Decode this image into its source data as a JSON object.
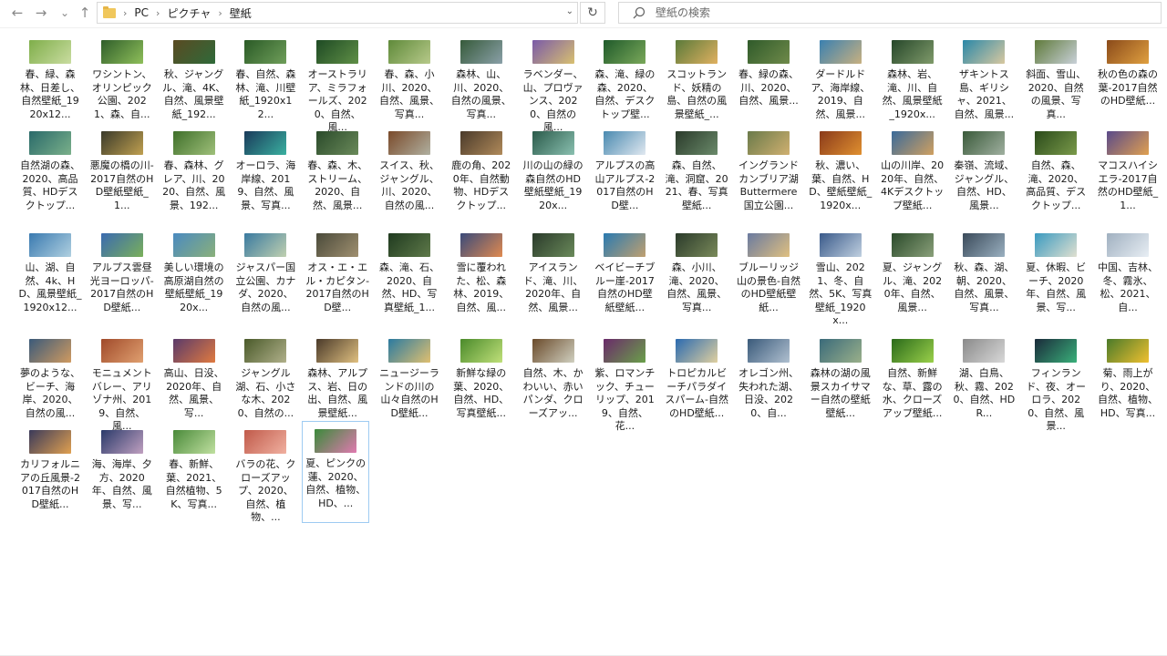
{
  "nav": {
    "back": "←",
    "forward": "→",
    "recent": "⌄",
    "up": "↑"
  },
  "breadcrumb": [
    "PC",
    "ピクチャ",
    "壁紙"
  ],
  "breadcrumb_sep": "›",
  "search": {
    "placeholder": "壁紙の検索"
  },
  "items": [
    {
      "label": "春、緑、森林、日差し、自然壁紙_1920x12...",
      "g": [
        "#7fae4a",
        "#c9dca0"
      ]
    },
    {
      "label": "ワシントン、オリンピック公園、2021、森、自...",
      "g": [
        "#2f5e2a",
        "#8fbf5a"
      ]
    },
    {
      "label": "秋、ジャングル、滝、4K、自然、風景壁紙_192...",
      "g": [
        "#5a4a22",
        "#2f6a3a"
      ]
    },
    {
      "label": "春、自然、森林、滝、川壁紙_1920x12...",
      "g": [
        "#2a5a26",
        "#6f9e5a"
      ]
    },
    {
      "label": "オーストラリア、ミラフォールズ、2020、自然、風...",
      "g": [
        "#1e4a24",
        "#5f8f46"
      ]
    },
    {
      "label": "春、森、小川、2020、自然、風景、写真...",
      "g": [
        "#5f8a3a",
        "#b7c98a"
      ]
    },
    {
      "label": "森林、山、川、2020、自然の風景、写真...",
      "g": [
        "#365a3a",
        "#8aa0a8"
      ]
    },
    {
      "label": "ラベンダー、山、プロヴァンス、2020、自然の風...",
      "g": [
        "#7a5aa8",
        "#d8c070"
      ]
    },
    {
      "label": "森、滝、緑の森、2020、自然、デスクトップ壁...",
      "g": [
        "#1f5a2a",
        "#7aa85a"
      ]
    },
    {
      "label": "スコットランド、妖精の島、自然の風景壁紙_...",
      "g": [
        "#5a7a3a",
        "#e0b060"
      ]
    },
    {
      "label": "春、緑の森、川、2020、自然、風景...",
      "g": [
        "#2f5a2a",
        "#6f8a4a"
      ]
    },
    {
      "label": "ダードルドア、海岸線、2019、自然、風景...",
      "g": [
        "#3a80b0",
        "#c8b080"
      ]
    },
    {
      "label": "森林、岩、滝、川、自然、風景壁紙_1920x...",
      "g": [
        "#26472a",
        "#7f9a6a"
      ]
    },
    {
      "label": "ザキントス島、ギリシャ、2021、自然、風景...",
      "g": [
        "#2a88a8",
        "#d8c8a0"
      ]
    },
    {
      "label": "斜面、雪山、2020、自然の風景、写真...",
      "g": [
        "#5f7a3a",
        "#c8d0d8"
      ]
    },
    {
      "label": "秋の色の森の葉-2017自然のHD壁紙...",
      "g": [
        "#8a4a1a",
        "#e0a040"
      ]
    },
    {
      "label": "自然湖の森、2020、高品質、HDデスクトップ...",
      "g": [
        "#2a6a6a",
        "#7ab08a"
      ]
    },
    {
      "label": "悪魔の橋の川-2017自然のHD壁紙壁紙_1...",
      "g": [
        "#3a3a2a",
        "#c0a050"
      ]
    },
    {
      "label": "春、森林、グレア、川、2020、自然、風景、192...",
      "g": [
        "#3f6f2a",
        "#9fc07a"
      ]
    },
    {
      "label": "オーロラ、海岸線、2019、自然、風景、写真...",
      "g": [
        "#1a3a5a",
        "#3ab0a0"
      ]
    },
    {
      "label": "春、森、木、ストリーム、2020、自然、風景...",
      "g": [
        "#2a4a2a",
        "#6a8a5a"
      ]
    },
    {
      "label": "スイス、秋、ジャングル、川、2020、自然の風...",
      "g": [
        "#7a4a2a",
        "#b0b0a0"
      ]
    },
    {
      "label": "鹿の角、2020年、自然動物、HDデスクトップ...",
      "g": [
        "#4a3a2a",
        "#b08a5a"
      ]
    },
    {
      "label": "川の山の緑の森自然のHD壁紙壁紙_1920x...",
      "g": [
        "#2a5a4a",
        "#8ac0b0"
      ]
    },
    {
      "label": "アルプスの高山アルプス-2017自然のHD壁...",
      "g": [
        "#4a8ab0",
        "#e0e8f0"
      ]
    },
    {
      "label": "森、自然、滝、洞窟、2021、春、写真壁紙...",
      "g": [
        "#2a3a2a",
        "#6a8a6a"
      ]
    },
    {
      "label": "イングランドカンブリア湖Buttermere国立公園...",
      "g": [
        "#6a7a4a",
        "#d0b070"
      ]
    },
    {
      "label": "秋、濃い、葉、自然、HD、壁紙壁紙_1920x...",
      "g": [
        "#8a3a1a",
        "#e09030"
      ]
    },
    {
      "label": "山の川岸、2020年、自然、4Kデスクトップ壁紙...",
      "g": [
        "#3a6a9a",
        "#d0a060"
      ]
    },
    {
      "label": "秦嶺、流域、ジャングル、自然、HD、風景...",
      "g": [
        "#3a5a3a",
        "#a0b0a0"
      ]
    },
    {
      "label": "自然、森、滝、2020、高品質、デスクトップ...",
      "g": [
        "#2a4a1a",
        "#7a9a4a"
      ]
    },
    {
      "label": "マコスハイシエラ-2017自然のHD壁紙_1...",
      "g": [
        "#5a4a8a",
        "#e0a050"
      ]
    },
    {
      "label": "山、湖、自然、4k、HD、風景壁紙_1920x12...",
      "g": [
        "#3a7ab0",
        "#b0d0e0"
      ]
    },
    {
      "label": "アルプス雲昼光ヨーロッパ-2017自然のHD壁紙...",
      "g": [
        "#3a6ab0",
        "#7ab05a"
      ]
    },
    {
      "label": "美しい環境の高原湖自然の壁紙壁紙_1920x...",
      "g": [
        "#4a8ac0",
        "#8ab07a"
      ]
    },
    {
      "label": "ジャスパー国立公園、カナダ、2020、自然の風...",
      "g": [
        "#3a7aa0",
        "#c0d0b0"
      ]
    },
    {
      "label": "オス・エ・エル・カピタン-2017自然のHD壁...",
      "g": [
        "#4a4a3a",
        "#a09070"
      ]
    },
    {
      "label": "森、滝、石、2020、自然、HD、写真壁紙_1...",
      "g": [
        "#1f3a1f",
        "#5f7a4a"
      ]
    },
    {
      "label": "雪に覆われた、松、森林、2019、自然、風...",
      "g": [
        "#3a4a7a",
        "#e08a50"
      ]
    },
    {
      "label": "アイスランド、滝、川、2020年、自然、風景...",
      "g": [
        "#2a3a2a",
        "#6a8a5a"
      ]
    },
    {
      "label": "ベイビーチブルー崖-2017自然のHD壁紙壁紙...",
      "g": [
        "#2a7ab0",
        "#c0a070"
      ]
    },
    {
      "label": "森、小川、滝、2020、自然、風景、写真...",
      "g": [
        "#2a3a2a",
        "#7a8a5a"
      ]
    },
    {
      "label": "ブルーリッジ山の景色-自然のHD壁紙壁紙...",
      "g": [
        "#6a7aa0",
        "#e0c080"
      ]
    },
    {
      "label": "雪山、2021、冬、自然、5K、写真壁紙_1920x...",
      "g": [
        "#3a5a8a",
        "#c0d0e0"
      ]
    },
    {
      "label": "夏、ジャングル、滝、2020年、自然、風景...",
      "g": [
        "#2a4a2a",
        "#8aa07a"
      ]
    },
    {
      "label": "秋、森、湖、朝、2020、自然、風景、写真...",
      "g": [
        "#3a4a5a",
        "#9ab0c0"
      ]
    },
    {
      "label": "夏、休暇、ビーチ、2020年、自然、風景、写...",
      "g": [
        "#3a9ac0",
        "#e0e0d0"
      ]
    },
    {
      "label": "中国、吉林、冬、霧氷、松、2021、自...",
      "g": [
        "#a0b0c0",
        "#e8eef4"
      ]
    },
    {
      "label": "夢のような、ビーチ、海岸、2020、自然の風...",
      "g": [
        "#3a5a7a",
        "#d09a60"
      ]
    },
    {
      "label": "モニュメントバレー、アリゾナ州、2019、自然、風...",
      "g": [
        "#a04a2a",
        "#e0a070"
      ]
    },
    {
      "label": "高山、日没、2020年、自然、風景、写...",
      "g": [
        "#5a3a6a",
        "#e07a40"
      ]
    },
    {
      "label": "ジャングル湖、石、小さな木、2020、自然の...",
      "g": [
        "#4a5a2a",
        "#b0b08a"
      ]
    },
    {
      "label": "森林、アルプス、岩、日の出、自然、風景壁紙...",
      "g": [
        "#4a3a2a",
        "#e0c080"
      ]
    },
    {
      "label": "ニュージーランドの川の山々自然のHD壁紙...",
      "g": [
        "#2a7aa0",
        "#e0c070"
      ]
    },
    {
      "label": "新鮮な緑の葉、2020、自然、HD、写真壁紙...",
      "g": [
        "#4a8a2a",
        "#c0e07a"
      ]
    },
    {
      "label": "自然、木、かわいい、赤いパンダ、クローズアッ...",
      "g": [
        "#6a4a2a",
        "#d0d0c0"
      ]
    },
    {
      "label": "紫、ロマンチック、チューリップ、2019、自然、花...",
      "g": [
        "#6a2a6a",
        "#6aa04a"
      ]
    },
    {
      "label": "トロピカルビーチパラダイスパーム-自然のHD壁紙...",
      "g": [
        "#2a6ab0",
        "#e0d0a0"
      ]
    },
    {
      "label": "オレゴン州、失われた湖、日没、2020、自...",
      "g": [
        "#3a5a7a",
        "#b0c0d0"
      ]
    },
    {
      "label": "森林の湖の風景スカイサマー自然の壁紙壁紙...",
      "g": [
        "#3a6a7a",
        "#9ab08a"
      ]
    },
    {
      "label": "自然、新鮮な、草、露の水、クローズアップ壁紙...",
      "g": [
        "#2a6a1a",
        "#9ad04a"
      ]
    },
    {
      "label": "湖、白鳥、秋、霧、2020、自然、HDR...",
      "g": [
        "#8a8a8a",
        "#d8d8d8"
      ]
    },
    {
      "label": "フィンランド、夜、オーロラ、2020、自然、風景...",
      "g": [
        "#1a2a3a",
        "#3ab07a"
      ]
    },
    {
      "label": "菊、雨上がり、2020、自然、植物、HD、写真...",
      "g": [
        "#4a7a2a",
        "#f0c030"
      ]
    },
    {
      "label": "カリフォルニアの丘風景-2017自然のHD壁紙...",
      "g": [
        "#3a3a5a",
        "#e0a050"
      ]
    },
    {
      "label": "海、海岸、夕方、2020年、自然、風景、写...",
      "g": [
        "#2a3a6a",
        "#c0a0c0"
      ]
    },
    {
      "label": "春、新鮮、葉、2021、自然植物、5K、写真...",
      "g": [
        "#4a8a3a",
        "#c0e0a0"
      ]
    },
    {
      "label": "バラの花、クローズアップ、2020、自然、植物、...",
      "g": [
        "#c05a4a",
        "#f0b0a0"
      ]
    },
    {
      "label": "夏、ピンクの蓮、2020、自然、植物、HD、...",
      "g": [
        "#3a8a3a",
        "#e07ab0"
      ]
    }
  ]
}
